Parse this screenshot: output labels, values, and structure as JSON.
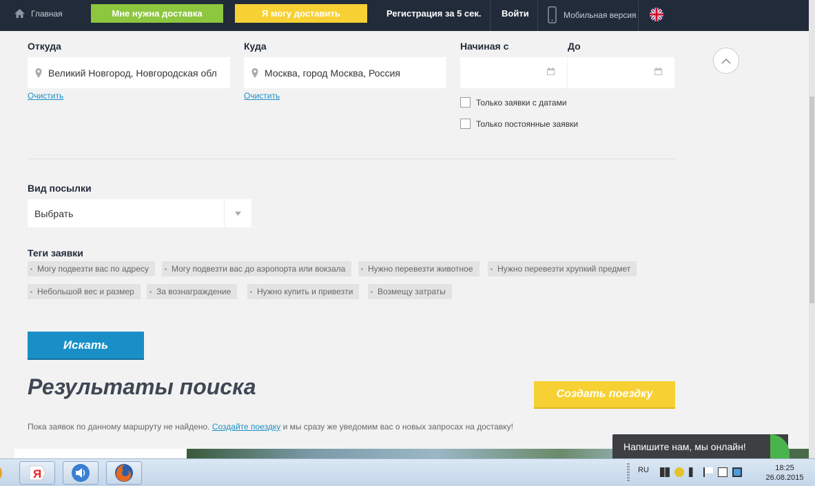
{
  "nav": {
    "home": "Главная",
    "need_delivery": "Мне нужна доставка",
    "can_deliver": "Я могу доставить",
    "register": "Регистрация за 5 сек.",
    "login": "Войти",
    "mobile": "Мобильная версия"
  },
  "form": {
    "from_label": "Откуда",
    "from_value": "Великий Новгород, Новгородская обл",
    "to_label": "Куда",
    "to_value": "Москва, город Москва, Россия",
    "clear": "Очистить",
    "start_label": "Начиная с",
    "until_label": "До",
    "only_dated": "Только заявки с датами",
    "only_permanent": "Только постоянные заявки",
    "parcel_label": "Вид посылки",
    "parcel_value": "Выбрать",
    "tags_label": "Теги заявки",
    "tags": [
      "Могу подвезти вас по адресу",
      "Могу подвезти вас до аэропорта или вокзала",
      "Нужно перевезти животное",
      "Нужно перевезти хрупкий предмет",
      "Небольшой вес и размер",
      "За вознаграждение",
      "Нужно купить и привезти",
      "Возмещу затраты"
    ],
    "search_button": "Искать"
  },
  "results": {
    "title": "Результаты поиска",
    "create_trip": "Создать поездку",
    "info_before": "Пока заявок по данному маршруту не найдено.",
    "info_link": "Создайте поездку",
    "info_after": "и мы сразу же уведомим вас о новых запросах на доставку!"
  },
  "chat": {
    "text": "Напишите нам, мы онлайн!"
  },
  "taskbar": {
    "lang": "RU",
    "time": "18:25",
    "date": "26.08.2015"
  },
  "colors": {
    "nav_bg": "#222b3a",
    "green": "#8dc63f",
    "yellow": "#f7d133",
    "blue": "#1a8fc7"
  }
}
